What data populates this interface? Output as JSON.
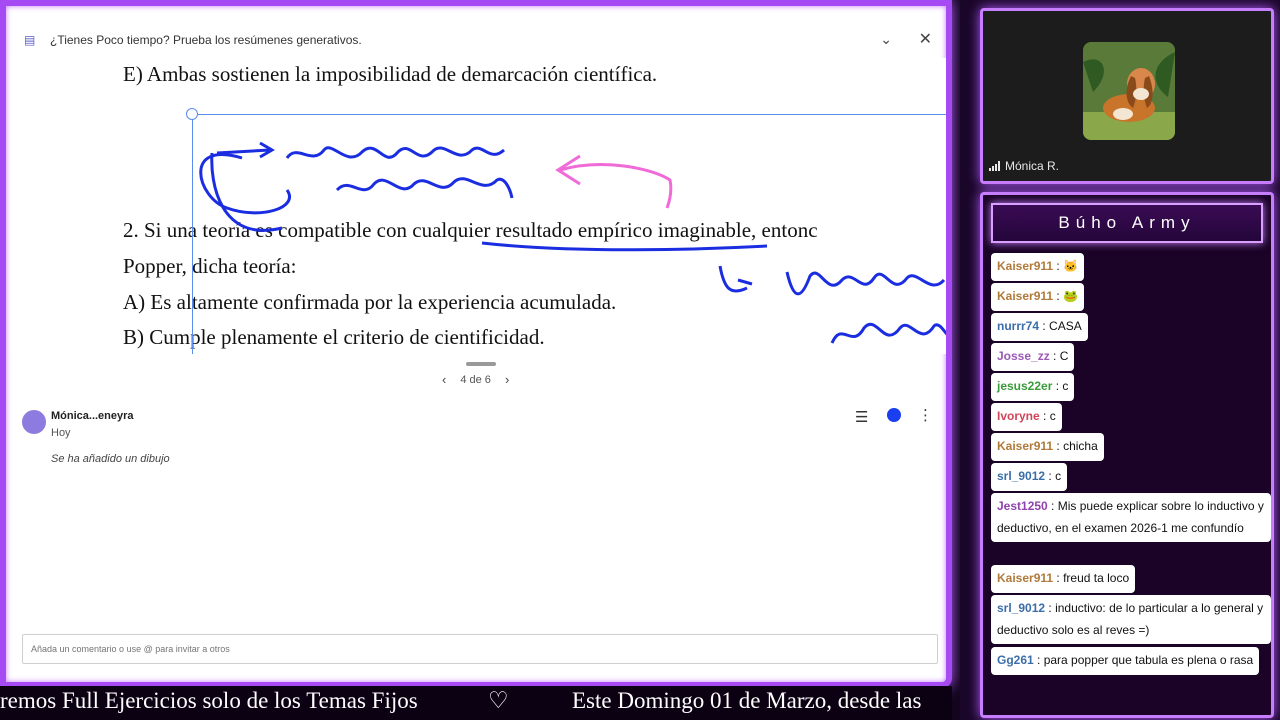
{
  "banner": {
    "text": "¿Tienes Poco tiempo? Prueba los resúmenes generativos.",
    "icon": "summary-icon",
    "expand_icon": "⌄",
    "close_icon": "✕"
  },
  "document": {
    "line_e": "E) Ambas sostienen la imposibilidad de demarcación científica.",
    "line_q2": "2. Si una teoría es compatible con cualquier resultado empírico imaginable, entonc",
    "line_popper": "Popper, dicha teoría:",
    "line_a": "A) Es altamente confirmada por la experiencia acumulada.",
    "line_b": "B) Cumple plenamente el criterio de cientificidad.",
    "ink_colors": {
      "blue": "#1a2de0",
      "pink": "#f06ad8",
      "selection": "#5b8def"
    }
  },
  "pager": {
    "prev": "‹",
    "label": "4 de 6",
    "next": "›"
  },
  "comment": {
    "author": "Mónica...eneyra",
    "time": "Hoy",
    "message": "Se ha añadido un dibujo",
    "list_icon": "☰",
    "more_icon": "⋮",
    "status_color": "#1a3ef0"
  },
  "comment_input": {
    "placeholder": "Añada un comentario o use @ para invitar a otros"
  },
  "ticker": {
    "left": "remos Full Ejercicios solo de los Temas Fijos",
    "heart": "♡",
    "right": "Este Domingo 01 de Marzo, desde las"
  },
  "webcam": {
    "name": "Mónica R."
  },
  "chat": {
    "title": "Búho Army",
    "messages": [
      {
        "user": "Kaiser911",
        "text": "🐱",
        "user_color": "#b07a3a"
      },
      {
        "user": "Kaiser911",
        "text": "🐸",
        "user_color": "#b07a3a"
      },
      {
        "user": "nurrr74",
        "text": "CASA",
        "user_color": "#3b6ea8"
      },
      {
        "user": "Josse_zz",
        "text": "C",
        "user_color": "#9b59b6"
      },
      {
        "user": "jesus22er",
        "text": "c",
        "user_color": "#3a9b3a"
      },
      {
        "user": "Ivoryne",
        "text": "c",
        "user_color": "#d0455a"
      },
      {
        "user": "Kaiser911",
        "text": "chicha",
        "user_color": "#b07a3a"
      },
      {
        "user": "srl_9012",
        "text": "c",
        "user_color": "#3b6ea8"
      },
      {
        "user": "Jest1250",
        "text": "Mis puede explicar sobre lo inductivo y deductivo, en el examen 2026-1 me confundío",
        "user_color": "#8e44ad"
      },
      {
        "user": "Kaiser911",
        "text": "freud ta loco",
        "user_color": "#b07a3a"
      },
      {
        "user": "srl_9012",
        "text": "inductivo: de lo particular a lo general y deductivo solo es al reves =)",
        "user_color": "#3b6ea8"
      },
      {
        "user": "Gg261",
        "text": "para popper que tabula es plena o rasa",
        "user_color": "#3b6ea8"
      }
    ]
  }
}
